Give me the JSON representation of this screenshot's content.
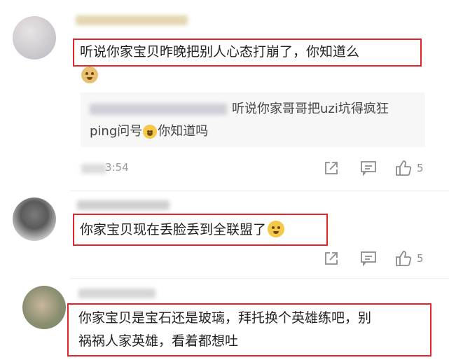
{
  "comments": [
    {
      "text": "听说你家宝贝昨晚把别人心态打崩了，你知道么",
      "reply": {
        "line1": "听说你家哥哥把uzi坑得疯狂",
        "line2_a": "ping问号",
        "line2_b": "你知道吗"
      },
      "time": "3:54",
      "likes": "5"
    },
    {
      "text": "你家宝贝现在丢脸丢到全联盟了",
      "likes": "5"
    },
    {
      "line1": "你家宝贝是宝石还是玻璃，拜托换个英雄练吧，别",
      "line2": "祸祸人家英雄，看着都想吐"
    }
  ],
  "colors": {
    "highlight_border": "#e0242a",
    "muted": "#9a9a9a"
  }
}
